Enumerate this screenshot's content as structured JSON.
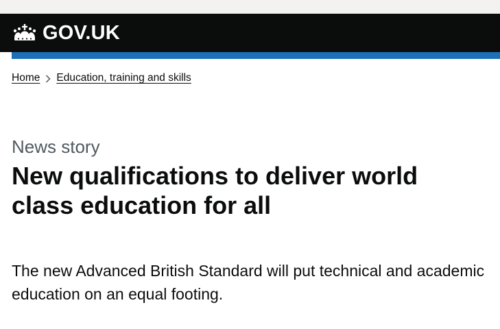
{
  "header": {
    "logo_text": "GOV.UK",
    "logo_icon": "crown-icon",
    "background": "#0b0c0c",
    "accent_bar_color": "#1d70b8"
  },
  "breadcrumbs": {
    "items": [
      {
        "label": "Home"
      },
      {
        "label": "Education, training and skills"
      }
    ],
    "separator_icon": "chevron-right-icon"
  },
  "article": {
    "caption": "News story",
    "title": "New qualifications to deliver world class education for all",
    "lead": "The new Advanced British Standard will put technical and academic education on an equal footing."
  }
}
